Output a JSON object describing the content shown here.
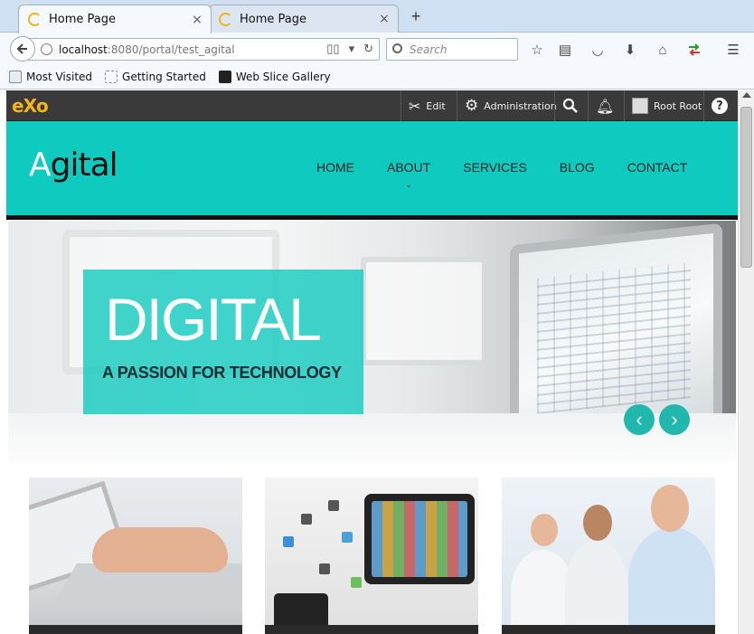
{
  "browser": {
    "tabs": [
      {
        "label": "Home Page",
        "close": "×"
      },
      {
        "label": "Home Page",
        "close": "×"
      }
    ],
    "new_tab": "+",
    "url": {
      "host": "localhost",
      "rest": ":8080/portal/test_agital"
    },
    "search_placeholder": "Search",
    "bookmarks": [
      "Most Visited",
      "Getting Started",
      "Web Slice Gallery"
    ]
  },
  "toolbar": {
    "logo": "eXo",
    "edit_label": "Edit",
    "admin_label": "Administration",
    "user_label": "Root Root",
    "help_label": "?"
  },
  "site": {
    "brand_first": "A",
    "brand_rest": "gital",
    "nav": [
      "HOME",
      "ABOUT",
      "SERVICES",
      "BLOG",
      "CONTACT"
    ],
    "about_caret": "⌄"
  },
  "hero": {
    "title": "DIGITAL",
    "subtitle": "A PASSION FOR TECHNOLOGY",
    "prev": "‹",
    "next": "›"
  },
  "colors": {
    "accent": "#0fcbbf",
    "toolbar_bg": "#3a3a3a",
    "exo_logo": "#f2b31c"
  }
}
